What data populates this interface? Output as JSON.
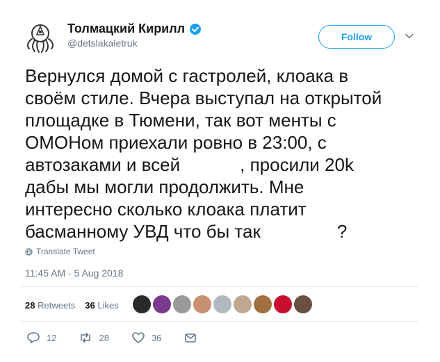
{
  "profile": {
    "display_name": "Толмацкий Кирилл",
    "handle": "@detslakaletruk",
    "avatar_icon": "octopus-logo",
    "verified_icon": "verified-badge-icon",
    "follow_label": "Follow"
  },
  "tweet": {
    "line1": "Вернулся домой с гастролей, клоака в",
    "line2": "своём стиле. Вчера выступал на открытой",
    "line3": "площадке в Тюмени, так вот менты с",
    "line4": "ОМОНом приехали ровно в 23:00, с",
    "line5a": "автозаками и всей",
    "line5b": ", просили 20k",
    "line6": "дабы мы могли продолжить. Мне",
    "line7": "интересно сколько клоака платит",
    "line8a": "басманному УВД что бы так",
    "line8b": "?",
    "translate_label": "Translate Tweet",
    "timestamp": "11:45 AM - 5 Aug 2018"
  },
  "stats": {
    "retweets_count": "28",
    "retweets_label": "Retweets",
    "likes_count": "36",
    "likes_label": "Likes",
    "liker_colors": [
      "#2a2a2a",
      "#7a3b8e",
      "#9a9a9a",
      "#c89070",
      "#b0b8c0",
      "#c0a890",
      "#a07040",
      "#c8102e",
      "#6a5040"
    ]
  },
  "actions": {
    "reply_count": "12",
    "retweet_count": "28",
    "like_count": "36"
  },
  "colors": {
    "accent": "#1da1f2",
    "secondary_text": "#657786"
  }
}
